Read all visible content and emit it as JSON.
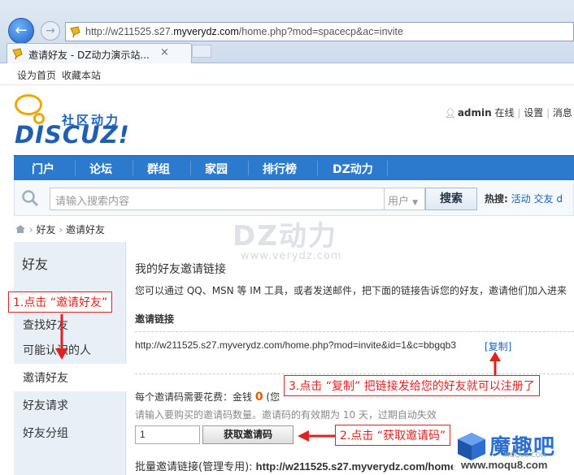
{
  "browser": {
    "address_prefix": "http://w211525.s27.",
    "address_domain": "myverydz.com",
    "address_suffix": "/home.php?mod=spacecp&ac=invite",
    "tab_title": "邀请好友 - DZ动力演示站...",
    "tab_close": "×"
  },
  "topbar": {
    "set_home": "设为首页",
    "bookmark": "收藏本站"
  },
  "header": {
    "logo_cn": "社区动力",
    "logo_en": "DISCUZ!",
    "username": "admin",
    "online": "在线",
    "settings": "设置",
    "messages": "消息"
  },
  "nav": {
    "items": [
      "门户",
      "论坛",
      "群组",
      "家园",
      "排行榜",
      "DZ动力"
    ]
  },
  "search": {
    "placeholder": "请输入搜索内容",
    "scope": "用户",
    "button": "搜索",
    "hot_label": "热搜:",
    "hot_1": "活动",
    "hot_2": "交友",
    "hot_3": "d"
  },
  "breadcrumb": {
    "item_1": "好友",
    "item_2": "邀请好友",
    "sep": "›"
  },
  "sidebar": {
    "title": "好友",
    "items": [
      "查找好友",
      "可能认识的人",
      "邀请好友",
      "好友请求",
      "好友分组"
    ]
  },
  "main": {
    "title": "我的好友邀请链接",
    "intro": "您可以通过 QQ、MSN 等 IM 工具，或者发送邮件，把下面的链接告诉您的好友，邀请他们加入进来",
    "section_title": "邀请链接",
    "invite_url": "http://w211525.s27.myverydz.com/home.php?mod=invite&id=1&c=bbgqb3",
    "copy": "[复制]",
    "cost_text": "每个邀请码需要花费：金钱",
    "cost_value": "0",
    "cost_tail": "(您",
    "hint": "请输入要购买的邀请码数量。邀请码的有效期为 10 天，过期自动失效",
    "qty_value": "1",
    "get_button": "获取邀请码",
    "batch_label": "批量邀请链接(管理专用):",
    "batch_url": "http://w211525.s27.myverydz.com/home"
  },
  "watermark": {
    "main": "DZ动力",
    "sub": "www.verydz.com",
    "moqu_name": "魔趣吧",
    "moqu_small": "MOQU8.COM",
    "moqu_url": "www.moqu8.com"
  },
  "annotations": {
    "step1": "1.点击 “邀请好友”",
    "step2": "2.点击 “获取邀请码”",
    "step3": "3.点击 “复制” 把链接发给您的好友就可以注册了"
  },
  "colors": {
    "nav_bg": "#2b7acd",
    "annotation": "#d22222",
    "link": "#1a62b8"
  }
}
